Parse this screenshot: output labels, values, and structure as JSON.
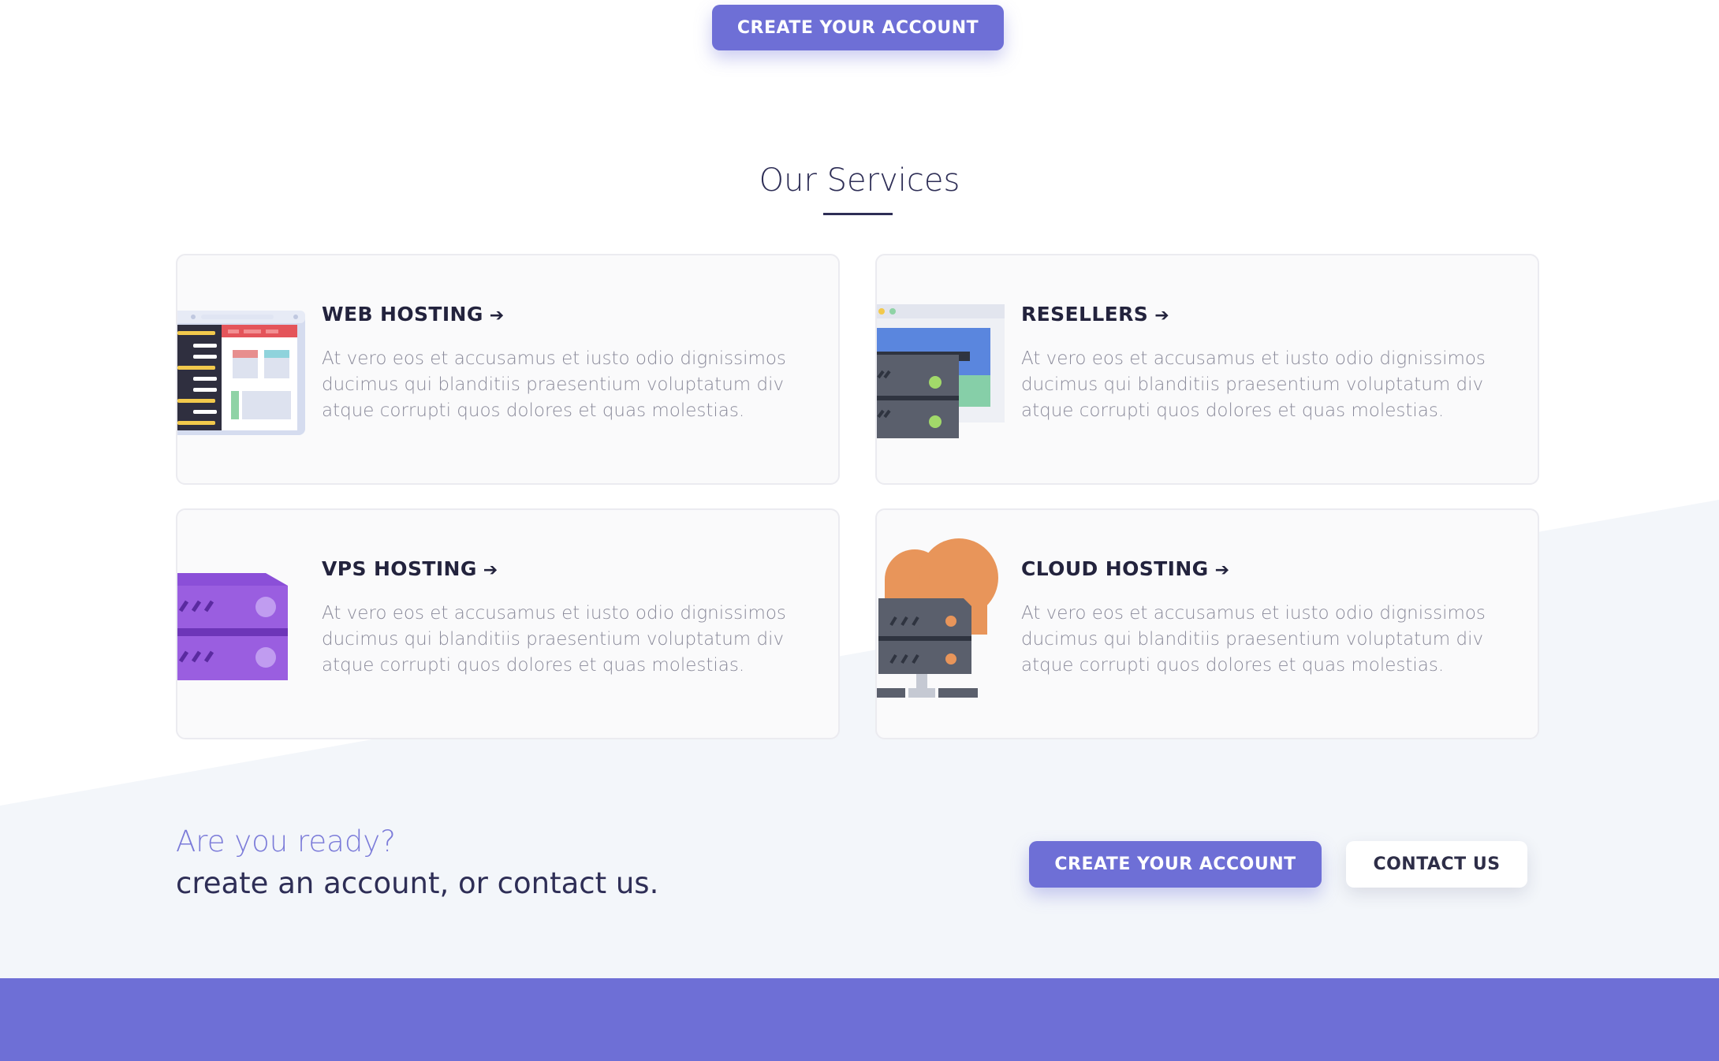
{
  "hero": {
    "cta_label": "CREATE YOUR ACCOUNT"
  },
  "services": {
    "title": "Our Services",
    "items": [
      {
        "heading": "WEB HOSTING",
        "arrow": "➔",
        "icon": "web-hosting-browser-icon",
        "description": "At vero eos et accusamus et iusto odio dignissimos ducimus qui blanditiis praesentium voluptatum div atque corrupti quos dolores et quas molestias."
      },
      {
        "heading": "RESELLERS",
        "arrow": "➔",
        "icon": "resellers-server-icon",
        "description": "At vero eos et accusamus et iusto odio dignissimos ducimus qui blanditiis praesentium voluptatum div atque corrupti quos dolores et quas molestias."
      },
      {
        "heading": "VPS HOSTING",
        "arrow": "➔",
        "icon": "vps-server-icon",
        "description": "At vero eos et accusamus et iusto odio dignissimos ducimus qui blanditiis praesentium voluptatum div atque corrupti quos dolores et quas molestias."
      },
      {
        "heading": "CLOUD HOSTING",
        "arrow": "➔",
        "icon": "cloud-server-icon",
        "description": "At vero eos et accusamus et iusto odio dignissimos ducimus qui blanditiis praesentium voluptatum div atque corrupti quos dolores et quas molestias."
      }
    ]
  },
  "cta_section": {
    "line1": "Are you ready?",
    "line2": "create an account, or contact us.",
    "primary_label": "CREATE YOUR ACCOUNT",
    "secondary_label": "CONTACT US"
  },
  "colors": {
    "accent": "#6e6fd6",
    "heading": "#2e2e56",
    "body_text": "#8a8a9a",
    "card_bg": "#fafafb",
    "section_bg": "#f3f6fa"
  }
}
